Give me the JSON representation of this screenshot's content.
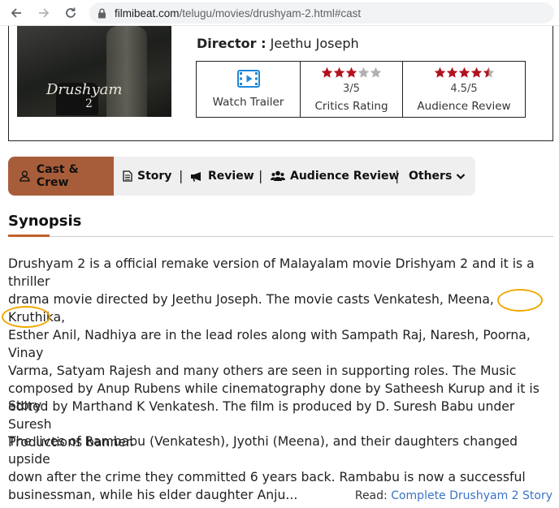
{
  "browser": {
    "url_host": "filmibeat.com",
    "url_path": "/telugu/movies/drushyam-2.html#cast"
  },
  "poster": {
    "title": "Drushyam",
    "number": "2"
  },
  "director": {
    "label": "Director :",
    "name": "Jeethu Joseph"
  },
  "info": {
    "trailer_label": "Watch Trailer",
    "critics": {
      "value": "3/5",
      "label": "Critics Rating",
      "stars_filled": 3,
      "stars_total": 5
    },
    "audience": {
      "value": "4.5/5",
      "label": "Audience Review",
      "stars_filled": 4.5,
      "stars_total": 5
    },
    "star_color": "#b3121f",
    "star_empty_color": "#b0b0b0"
  },
  "tabs": [
    {
      "label": "Cast & Crew",
      "icon": "user-icon",
      "active": true
    },
    {
      "label": "Story",
      "icon": "document-icon"
    },
    {
      "label": "Review",
      "icon": "megaphone-icon"
    },
    {
      "label": "Audience Review",
      "icon": "users-icon"
    },
    {
      "label": "Others",
      "icon": "chevron-down-icon"
    }
  ],
  "synopsis": {
    "title": "Synopsis",
    "lines": [
      "Drushyam 2 is a official remake version of Malayalam movie Drishyam 2 and it is a thriller",
      "drama movie directed by Jeethu Joseph. The movie casts Venkatesh, Meena, Kruthika,",
      "Esther Anil, Nadhiya are in the lead roles along with Sampath Raj, Naresh, Poorna, Vinay",
      "Varma, Satyam Rajesh and many others are seen in supporting roles. The Music",
      "composed by Anup Rubens while cinematography done by Satheesh Kurup and it is",
      "edited by Marthand K Venkatesh. The film is produced by D. Suresh Babu under Suresh",
      "Productions banner."
    ],
    "story_label": "Story",
    "story_lines": [
      "The lives of Rambabu (Venkatesh), Jyothi (Meena), and their daughters changed upside",
      "down after the crime they committed 6 years back. Rambabu is now a successful",
      "businessman, while his elder daughter Anju..."
    ]
  },
  "read_more": {
    "prefix": "Read:",
    "link": "Complete Drushyam 2 Story"
  },
  "colors": {
    "active_tab": "#a85d3a",
    "accent_underline": "#c45f2e",
    "link": "#3a73c6",
    "annotation": "#f0a800"
  }
}
